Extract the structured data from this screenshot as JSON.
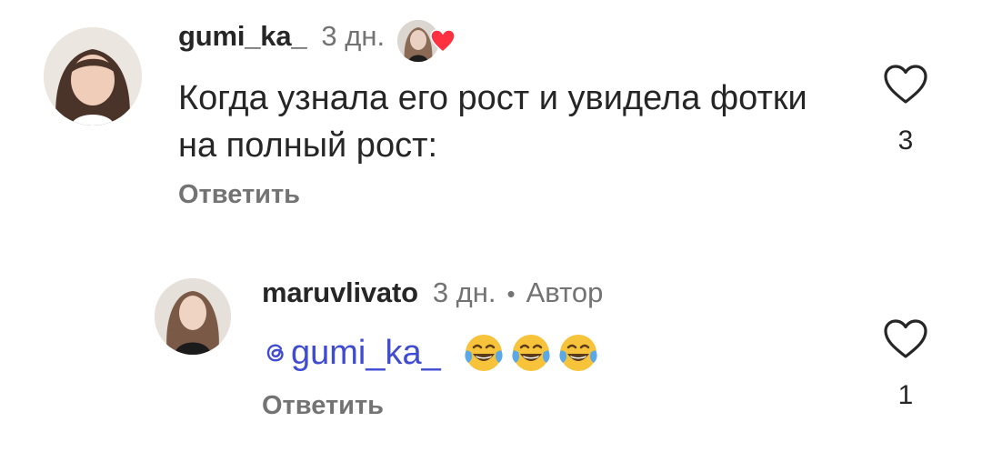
{
  "comments": [
    {
      "username": "gumi_ka_",
      "time": "3 дн.",
      "text": "Когда узнала его рост и увидела фотки на полный рост:",
      "reply_label": "Ответить",
      "likes": "3",
      "liked_by_author": true
    },
    {
      "username": "maruvlivato",
      "time": "3 дн.",
      "separator": "•",
      "author_badge": "Автор",
      "mention": "gumi_ka_",
      "emoji": [
        "face-with-tears-of-joy",
        "face-with-tears-of-joy",
        "face-with-tears-of-joy"
      ],
      "reply_label": "Ответить",
      "likes": "1"
    }
  ],
  "colors": {
    "text": "#262626",
    "muted": "#737373",
    "mention": "#3f4bd1",
    "heart_red": "#ff3040"
  }
}
